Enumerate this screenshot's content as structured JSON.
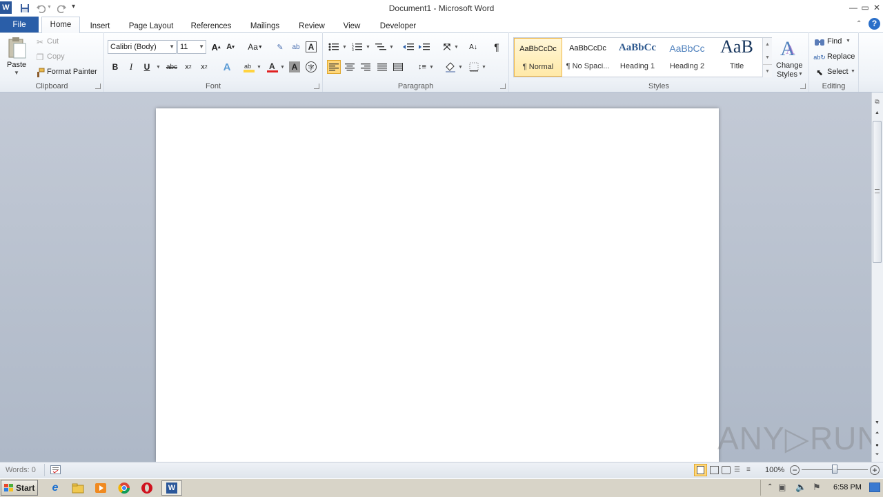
{
  "window": {
    "title": "Document1 - Microsoft Word"
  },
  "tabs": {
    "file": "File",
    "items": [
      "Home",
      "Insert",
      "Page Layout",
      "References",
      "Mailings",
      "Review",
      "View",
      "Developer"
    ]
  },
  "clipboard": {
    "group_label": "Clipboard",
    "paste": "Paste",
    "cut": "Cut",
    "copy": "Copy",
    "format_painter": "Format Painter"
  },
  "font": {
    "group_label": "Font",
    "font_name": "Calibri (Body)",
    "font_size": "11",
    "change_case": "Aa"
  },
  "paragraph": {
    "group_label": "Paragraph"
  },
  "styles": {
    "group_label": "Styles",
    "items": [
      {
        "preview": "AaBbCcDc",
        "name": "¶ Normal"
      },
      {
        "preview": "AaBbCcDc",
        "name": "¶ No Spaci..."
      },
      {
        "preview": "AaBbCc",
        "name": "Heading 1"
      },
      {
        "preview": "AaBbCc",
        "name": "Heading 2"
      },
      {
        "preview": "AaB",
        "name": "Title"
      }
    ],
    "change_styles_line1": "Change",
    "change_styles_line2": "Styles"
  },
  "editing": {
    "group_label": "Editing",
    "find": "Find",
    "replace": "Replace",
    "select": "Select"
  },
  "status": {
    "words": "Words: 0",
    "zoom": "100%"
  },
  "taskbar": {
    "start": "Start",
    "time": "6:58 PM"
  },
  "watermark": "ANY▷RUN",
  "colors": {
    "file_tab": "#2a5ea8",
    "document_background": "#b6bfcd",
    "highlight": "#ffd33f",
    "font_color": "#e02020"
  }
}
